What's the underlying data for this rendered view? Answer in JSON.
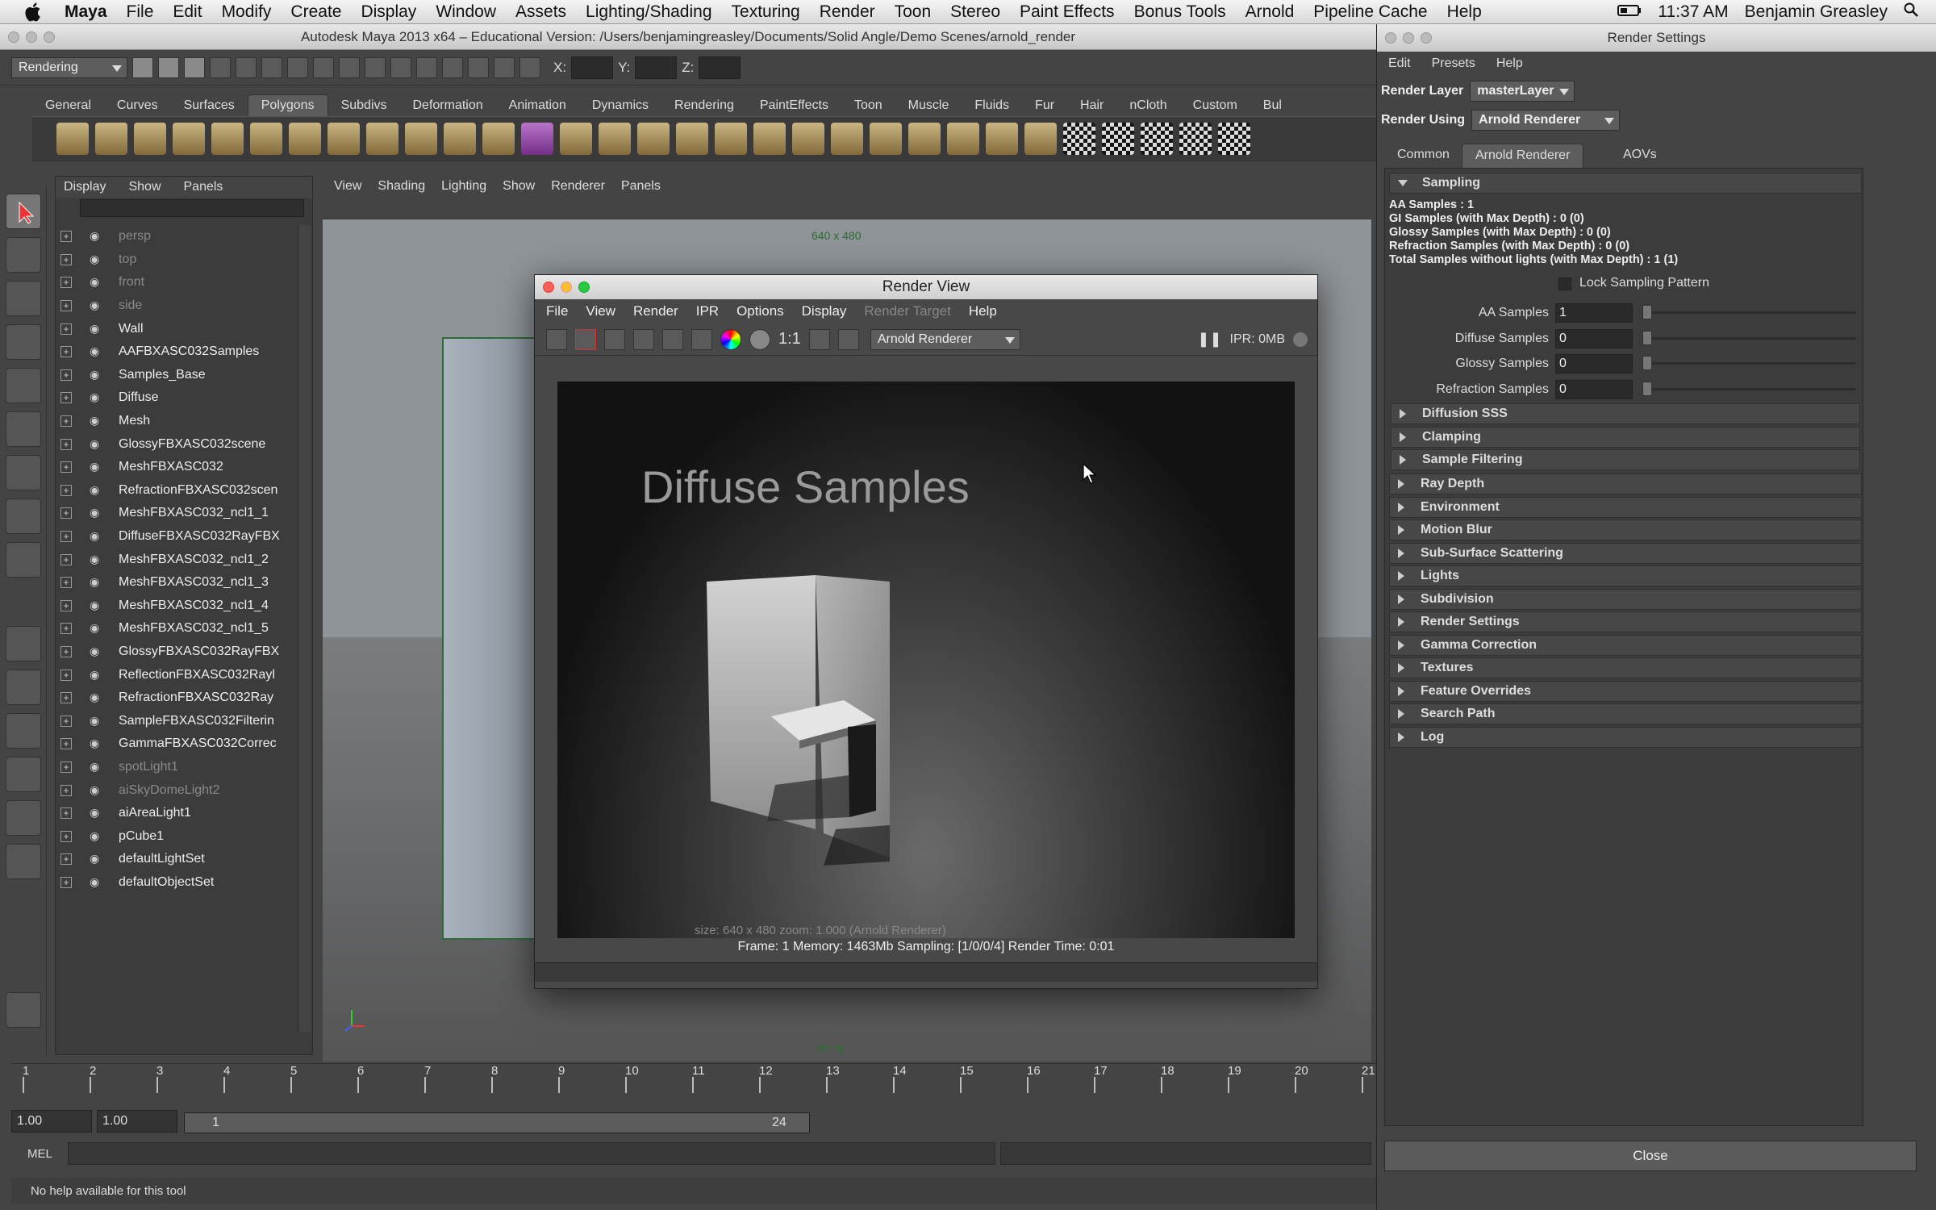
{
  "menubar": {
    "items": [
      "Maya",
      "File",
      "Edit",
      "Modify",
      "Create",
      "Display",
      "Window",
      "Assets",
      "Lighting/Shading",
      "Texturing",
      "Render",
      "Toon",
      "Stereo",
      "Paint Effects",
      "Bonus Tools",
      "Arnold",
      "Pipeline Cache",
      "Help"
    ],
    "time": "11:37 AM",
    "user": "Benjamin Greasley"
  },
  "maya": {
    "title": "Autodesk Maya 2013 x64 – Educational Version: /Users/benjamingreasley/Documents/Solid Angle/Demo Scenes/arnold_render",
    "menu_set": "Rendering",
    "shelf_tabs": [
      "General",
      "Curves",
      "Surfaces",
      "Polygons",
      "Subdivs",
      "Deformation",
      "Animation",
      "Dynamics",
      "Rendering",
      "PaintEffects",
      "Toon",
      "Muscle",
      "Fluids",
      "Fur",
      "Hair",
      "nCloth",
      "Custom",
      "Bul"
    ],
    "active_shelf_tab": "Polygons",
    "xyz_labels": [
      "X:",
      "Y:",
      "Z:"
    ]
  },
  "outliner": {
    "menu": [
      "Display",
      "Show",
      "Panels"
    ],
    "items": [
      {
        "label": "persp",
        "dim": true
      },
      {
        "label": "top",
        "dim": true
      },
      {
        "label": "front",
        "dim": true
      },
      {
        "label": "side",
        "dim": true
      },
      {
        "label": "Wall"
      },
      {
        "label": "AAFBXASC032Samples"
      },
      {
        "label": "Samples_Base"
      },
      {
        "label": "Diffuse"
      },
      {
        "label": "Mesh"
      },
      {
        "label": "GlossyFBXASC032scene"
      },
      {
        "label": "MeshFBXASC032"
      },
      {
        "label": "RefractionFBXASC032scen"
      },
      {
        "label": "MeshFBXASC032_ncl1_1"
      },
      {
        "label": "DiffuseFBXASC032RayFBX"
      },
      {
        "label": "MeshFBXASC032_ncl1_2"
      },
      {
        "label": "MeshFBXASC032_ncl1_3"
      },
      {
        "label": "MeshFBXASC032_ncl1_4"
      },
      {
        "label": "MeshFBXASC032_ncl1_5"
      },
      {
        "label": "GlossyFBXASC032RayFBX"
      },
      {
        "label": "ReflectionFBXASC032Rayl"
      },
      {
        "label": "RefractionFBXASC032Ray"
      },
      {
        "label": "SampleFBXASC032Filterin"
      },
      {
        "label": "GammaFBXASC032Correc"
      },
      {
        "label": "spotLight1",
        "dim": true
      },
      {
        "label": "aiSkyDomeLight2",
        "dim": true
      },
      {
        "label": "aiAreaLight1"
      },
      {
        "label": "pCube1"
      },
      {
        "label": "defaultLightSet"
      },
      {
        "label": "defaultObjectSet"
      }
    ]
  },
  "viewport": {
    "menu": [
      "View",
      "Shading",
      "Lighting",
      "Show",
      "Renderer",
      "Panels"
    ],
    "resolution": "640 x 480",
    "camera": "persp"
  },
  "timeline": {
    "ticks": [
      "1",
      "2",
      "3",
      "4",
      "5",
      "6",
      "7",
      "8",
      "9",
      "10",
      "11",
      "12",
      "13",
      "14",
      "15",
      "16",
      "17",
      "18",
      "19",
      "20",
      "21"
    ],
    "start": "1.00",
    "start2": "1.00",
    "range_start": "1",
    "range_end": "24",
    "mel_label": "MEL",
    "help": "No help available for this tool"
  },
  "render_view": {
    "title": "Render View",
    "menu": [
      "File",
      "View",
      "Render",
      "IPR",
      "Options",
      "Display",
      "Render Target",
      "Help"
    ],
    "renderer": "Arnold Renderer",
    "ratio": "1:1",
    "ipr": "IPR: 0MB",
    "scene_text": "Diffuse Samples",
    "size_line": "size: 640 x 480  zoom: 1.000     (Arnold Renderer)",
    "info": "Frame: 1    Memory: 1463Mb    Sampling: [1/0/0/4]    Render Time: 0:01"
  },
  "render_settings": {
    "title": "Render Settings",
    "menu": [
      "Edit",
      "Presets",
      "Help"
    ],
    "render_layer_label": "Render Layer",
    "render_layer": "masterLayer",
    "render_using_label": "Render Using",
    "render_using": "Arnold Renderer",
    "tabs": [
      "Common",
      "Arnold Renderer",
      "AOVs"
    ],
    "active_tab": "Arnold Renderer",
    "sampling_title": "Sampling",
    "summary": [
      "AA Samples : 1",
      "GI Samples (with Max Depth) : 0 (0)",
      "Glossy Samples (with Max Depth) : 0 (0)",
      "Refraction Samples (with Max Depth) : 0 (0)",
      "Total Samples without lights (with Max Depth) : 1 (1)"
    ],
    "lock_sampling": "Lock Sampling Pattern",
    "attrs": [
      {
        "label": "AA Samples",
        "value": "1"
      },
      {
        "label": "Diffuse Samples",
        "value": "0"
      },
      {
        "label": "Glossy Samples",
        "value": "0"
      },
      {
        "label": "Refraction Samples",
        "value": "0"
      }
    ],
    "sub_sections": [
      "Diffusion SSS",
      "Clamping",
      "Sample Filtering"
    ],
    "sections": [
      "Ray Depth",
      "Environment",
      "Motion Blur",
      "Sub-Surface Scattering",
      "Lights",
      "Subdivision",
      "Render Settings",
      "Gamma Correction",
      "Textures",
      "Feature Overrides",
      "Search Path",
      "Log"
    ],
    "close": "Close"
  }
}
